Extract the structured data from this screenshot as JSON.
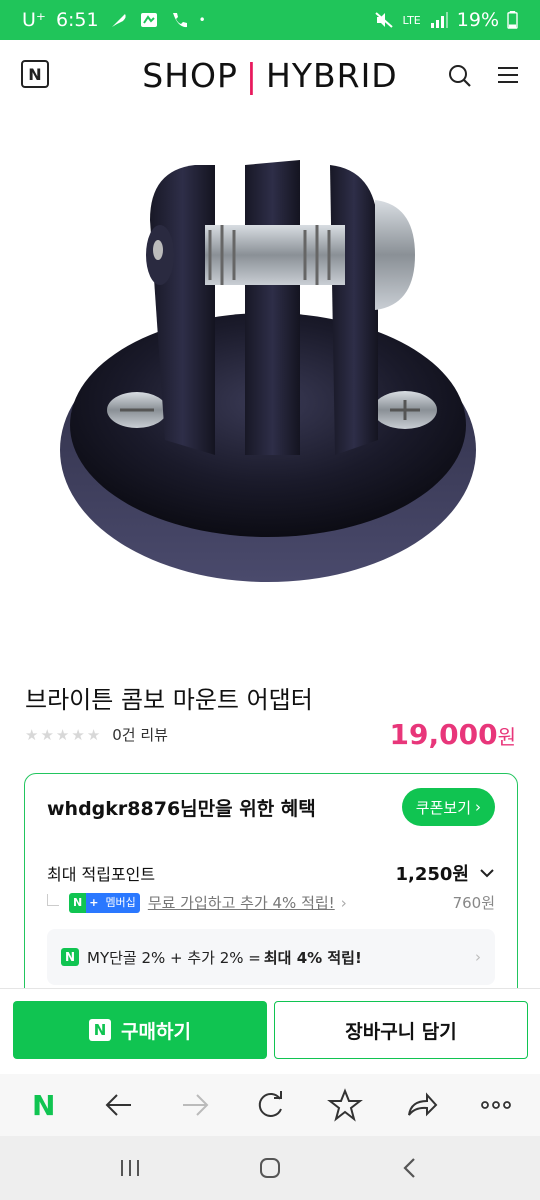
{
  "status_bar": {
    "carrier": "U⁺",
    "time": "6:51",
    "network": "LTE",
    "battery": "19%"
  },
  "header": {
    "brand_left": "SHOP",
    "brand_sep": "|",
    "brand_right": "HYBRID",
    "logo_letter": "N"
  },
  "product": {
    "title": "브라이튼 콤보 마운트 어댑터",
    "rating_stars": 0,
    "review_text": "0건 리뷰",
    "price": "19,000",
    "price_unit": "원"
  },
  "benefit": {
    "title": "whdgkr8876님만을 위한 혜택",
    "coupon_label": "쿠폰보기",
    "points_label": "최대 적립포인트",
    "points_value": "1,250원",
    "member_badge_n": "N",
    "member_badge_plus": "+",
    "member_badge_text": "멤버십",
    "member_link": "무료 가입하고 추가 4% 적립!",
    "member_value": "760원",
    "mydan_n": "N",
    "mydan_prefix": "MY단골 2% + 추가 2% =",
    "mydan_bold": "최대 4% 적립!"
  },
  "actions": {
    "buy_n": "N",
    "buy_label": "구매하기",
    "cart_label": "장바구니 담기"
  },
  "browser_bar": {
    "home_label": "N"
  },
  "colors": {
    "accent_green": "#10c451",
    "price_pink": "#e8367a",
    "status_green": "#20c55a"
  }
}
